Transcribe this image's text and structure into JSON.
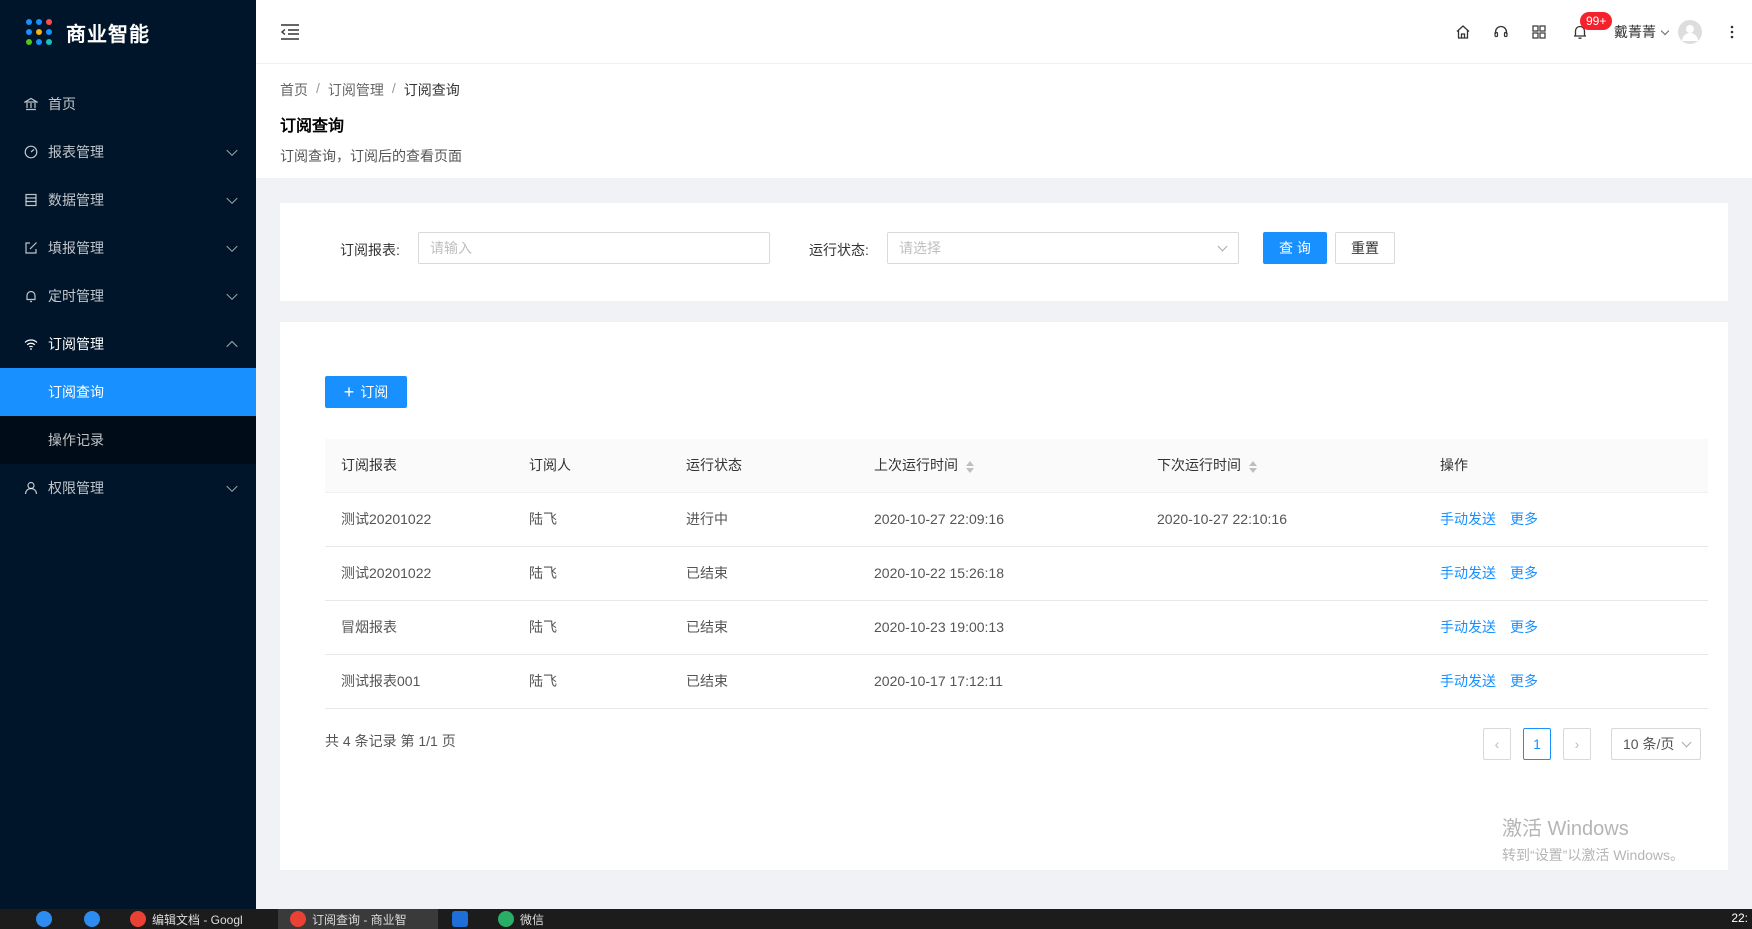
{
  "app": {
    "title": "商业智能"
  },
  "sidebar": {
    "items": [
      {
        "label": "首页",
        "icon": "bank-icon"
      },
      {
        "label": "报表管理",
        "icon": "dashboard-icon"
      },
      {
        "label": "数据管理",
        "icon": "database-icon"
      },
      {
        "label": "填报管理",
        "icon": "edit-icon"
      },
      {
        "label": "定时管理",
        "icon": "bell-icon"
      },
      {
        "label": "订阅管理",
        "icon": "wifi-icon"
      },
      {
        "label": "权限管理",
        "icon": "user-icon"
      }
    ],
    "submenu": [
      {
        "label": "订阅查询",
        "active": true
      },
      {
        "label": "操作记录",
        "active": false
      }
    ]
  },
  "header": {
    "badge": "99+",
    "user_name": "戴菁菁"
  },
  "breadcrumb": [
    "首页",
    "订阅管理",
    "订阅查询"
  ],
  "page": {
    "title": "订阅查询",
    "description": "订阅查询，订阅后的查看页面"
  },
  "search": {
    "report_label": "订阅报表:",
    "report_placeholder": "请输入",
    "status_label": "运行状态:",
    "status_placeholder": "请选择",
    "query_button": "查 询",
    "reset_button": "重置"
  },
  "table": {
    "add_button": "订阅",
    "columns": [
      "订阅报表",
      "订阅人",
      "运行状态",
      "上次运行时间",
      "下次运行时间",
      "操作"
    ],
    "rows": [
      {
        "report": "测试20201022",
        "user": "陆飞",
        "status": "进行中",
        "last_run": "2020-10-27 22:09:16",
        "next_run": "2020-10-27 22:10:16"
      },
      {
        "report": "测试20201022",
        "user": "陆飞",
        "status": "已结束",
        "last_run": "2020-10-22 15:26:18",
        "next_run": ""
      },
      {
        "report": "冒烟报表",
        "user": "陆飞",
        "status": "已结束",
        "last_run": "2020-10-23 19:00:13",
        "next_run": ""
      },
      {
        "report": "测试报表001",
        "user": "陆飞",
        "status": "已结束",
        "last_run": "2020-10-17 17:12:11",
        "next_run": ""
      }
    ],
    "action_send": "手动发送",
    "action_more": "更多"
  },
  "pagination": {
    "summary": "共 4 条记录 第 1/1 页",
    "current_page": "1",
    "page_size": "10 条/页"
  },
  "watermark": {
    "line1": "激活 Windows",
    "line2": "转到“设置”以激活 Windows。"
  },
  "taskbar": {
    "items": [
      "编辑文档 - Googl",
      "订阅查询 - 商业智",
      "微信"
    ],
    "clock": "22:"
  },
  "colors": {
    "primary": "#1890ff",
    "sidebar": "#001529",
    "badge": "#f5222d"
  }
}
